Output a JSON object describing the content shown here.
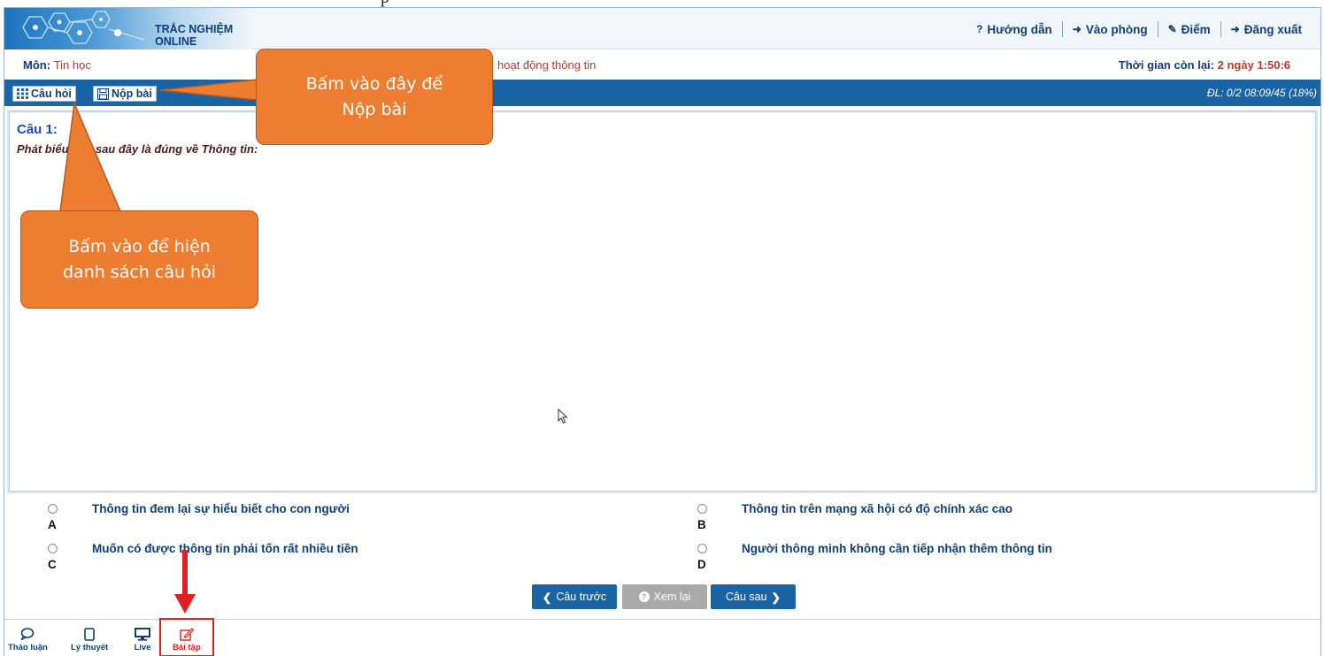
{
  "doc_header_fragment": "p",
  "header": {
    "logo_text": "TRẮC NGHIỆM ONLINE",
    "nav": [
      {
        "icon": "?",
        "label": "Hướng dẫn"
      },
      {
        "icon": "➜",
        "label": "Vào phòng"
      },
      {
        "icon": "✎",
        "label": "Điểm"
      },
      {
        "icon": "➜",
        "label": "Đăng xuất"
      }
    ]
  },
  "subject": {
    "label": "Môn:",
    "value": "Tin học",
    "lesson": "hoạt động thông tin",
    "timer_label": "Thời gian còn lại:",
    "timer_value": "2 ngày 1:50:6"
  },
  "toolbar": {
    "questions_label": "Câu hỏi",
    "submit_label": "Nộp bài",
    "status": "ĐL: 0/2  08:09/45 (18%)"
  },
  "question": {
    "title": "Câu 1:",
    "text": "Phát biểu nào sau đây là đúng về Thông tin:"
  },
  "answers": [
    {
      "letter": "A",
      "text": "Thông tin đem lại sự hiểu biết cho con người"
    },
    {
      "letter": "B",
      "text": "Thông tin trên mạng xã hội có độ chính xác cao"
    },
    {
      "letter": "C",
      "text": "Muốn có được thông tin phải tốn rất nhiều tiền"
    },
    {
      "letter": "D",
      "text": "Người thông minh không cần tiếp nhận thêm thông tin"
    }
  ],
  "nav_buttons": {
    "prev": "Câu trước",
    "review": "Xem lại",
    "next": "Câu sau"
  },
  "bottom_tabs": [
    {
      "label": "Thảo luận",
      "icon": "chat-icon"
    },
    {
      "label": "Lý thuyết",
      "icon": "tablet-icon"
    },
    {
      "label": "Live",
      "icon": "monitor-icon"
    },
    {
      "label": "Bài tập",
      "icon": "edit-icon",
      "active": true
    }
  ],
  "callouts": {
    "submit": [
      "Bấm vào đây để",
      "Nộp bài"
    ],
    "list": [
      "Bấm vào để hiện",
      "danh sách câu hỏi"
    ]
  },
  "colors": {
    "primary": "#1a63a5",
    "callout": "#ed7d31",
    "highlight": "#e02020",
    "title_blue": "#1a4fb5"
  }
}
